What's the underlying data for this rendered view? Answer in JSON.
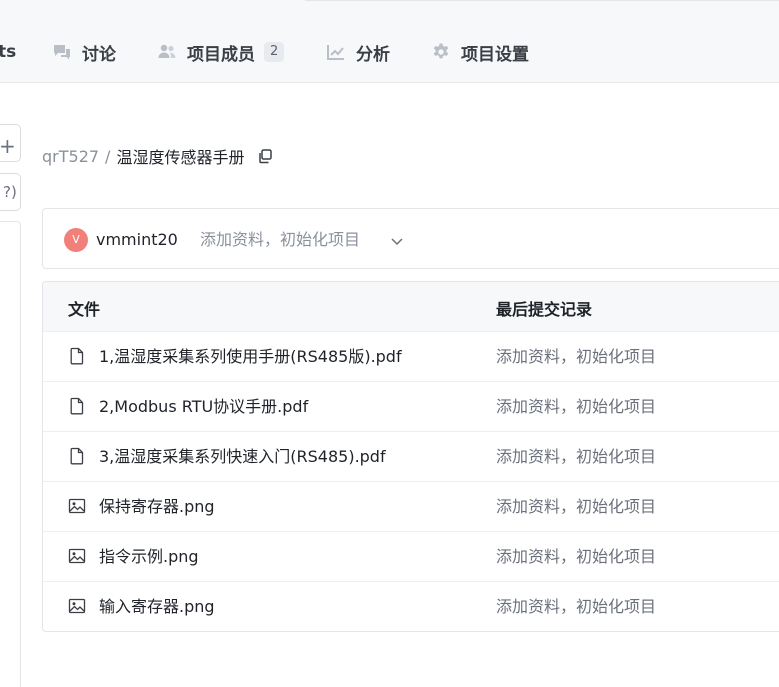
{
  "nav": {
    "tabs": [
      {
        "label": "ts",
        "icon": "truncated-tab"
      },
      {
        "label": "讨论",
        "icon": "chat-bubbles-icon"
      },
      {
        "label": "项目成员",
        "icon": "users-icon",
        "badge": "2"
      },
      {
        "label": "分析",
        "icon": "line-chart-icon"
      },
      {
        "label": "项目设置",
        "icon": "gear-icon"
      }
    ]
  },
  "left": {
    "plus_label": "+",
    "paren_label": "?)"
  },
  "breadcrumb": {
    "owner": "qrT527",
    "separator": "/",
    "repo": "温湿度传感器手册"
  },
  "commit": {
    "avatar_letter": "V",
    "avatar_color": "#f08079",
    "author": "vmmint20",
    "message": "添加资料，初始化项目"
  },
  "table": {
    "headers": {
      "file": "文件",
      "commit": "最后提交记录"
    },
    "rows": [
      {
        "name": "1,温湿度采集系列使用手册(RS485版).pdf",
        "icon": "file-icon",
        "commit": "添加资料，初始化项目"
      },
      {
        "name": "2,Modbus RTU协议手册.pdf",
        "icon": "file-icon",
        "commit": "添加资料，初始化项目"
      },
      {
        "name": "3,温湿度采集系列快速入门(RS485).pdf",
        "icon": "file-icon",
        "commit": "添加资料，初始化项目"
      },
      {
        "name": "保持寄存器.png",
        "icon": "image-icon",
        "commit": "添加资料，初始化项目"
      },
      {
        "name": "指令示例.png",
        "icon": "image-icon",
        "commit": "添加资料，初始化项目"
      },
      {
        "name": "输入寄存器.png",
        "icon": "image-icon",
        "commit": "添加资料，初始化项目"
      }
    ]
  }
}
